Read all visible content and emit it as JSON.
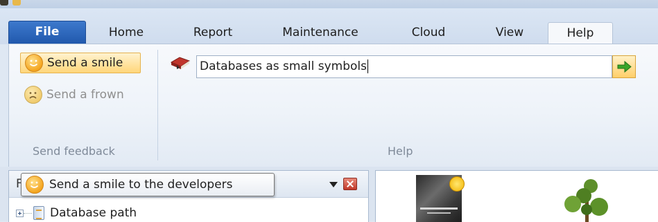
{
  "menu_tabs": [
    {
      "label": "File"
    },
    {
      "label": "Home"
    },
    {
      "label": "Report"
    },
    {
      "label": "Maintenance"
    },
    {
      "label": "Cloud"
    },
    {
      "label": "View"
    },
    {
      "label": "Help",
      "active": true
    }
  ],
  "ribbon": {
    "feedback_group": {
      "send_smile": "Send a smile",
      "send_frown": "Send a frown",
      "label": "Send feedback"
    },
    "help_group": {
      "search_value": "Databases as small symbols",
      "label": "Help"
    }
  },
  "left_panel": {
    "header_letter": "F",
    "tree": [
      {
        "label": "Database path"
      }
    ]
  },
  "tooltip": {
    "text": "Send a smile to the developers"
  },
  "colors": {
    "file_tab": "#2a63b8",
    "accent_button": "#ffd67a",
    "go_arrow": "#3aa52a",
    "close_button": "#c1392b"
  },
  "icons": [
    "smile-icon",
    "frown-icon",
    "help-book-icon",
    "go-arrow-icon",
    "dropdown-arrow-icon",
    "close-icon",
    "database-icon"
  ]
}
